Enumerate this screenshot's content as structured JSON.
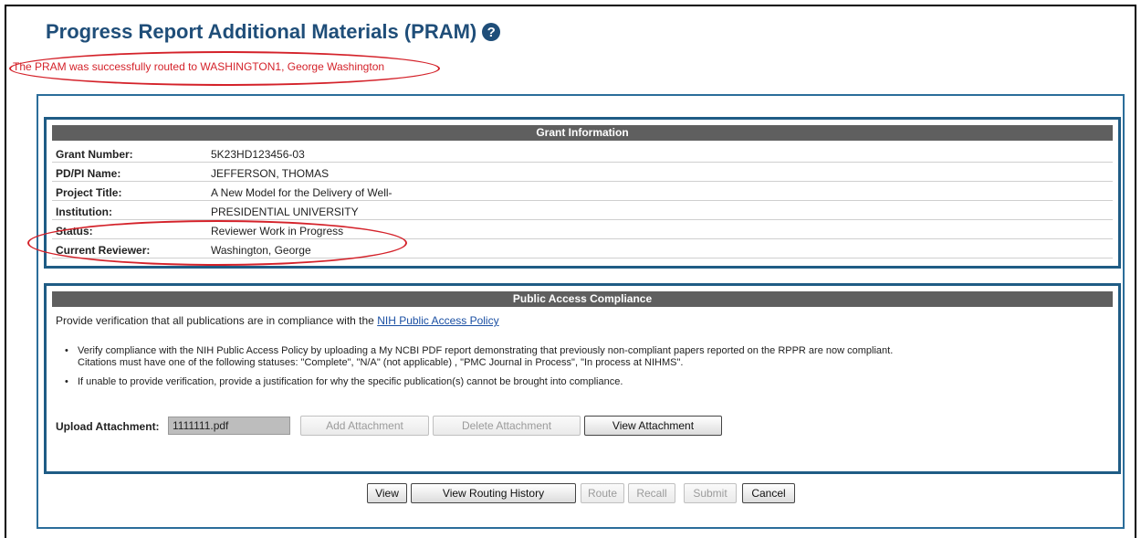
{
  "page": {
    "title": "Progress Report Additional Materials (PRAM)",
    "help_icon": "question-circle-icon",
    "success_message": "The PRAM was successfully routed to WASHINGTON1, George Washington"
  },
  "grant_info": {
    "header": "Grant Information",
    "rows": [
      {
        "label": "Grant Number:",
        "value": "5K23HD123456-03"
      },
      {
        "label": "PD/PI Name:",
        "value": "JEFFERSON, THOMAS"
      },
      {
        "label": "Project Title:",
        "value": "A New Model for the Delivery of Well-"
      },
      {
        "label": "Institution:",
        "value": "PRESIDENTIAL UNIVERSITY"
      },
      {
        "label": "Status:",
        "value": "Reviewer Work in Progress"
      },
      {
        "label": "Current Reviewer:",
        "value": "Washington, George"
      }
    ]
  },
  "public_access": {
    "header": "Public Access Compliance",
    "intro": "Provide verification that all publications are in compliance with the",
    "policy_link": "NIH Public Access Policy",
    "bullet1_line1": "Verify compliance with the NIH Public Access Policy by uploading a My NCBI PDF report demonstrating that previously non-compliant papers reported on the RPPR are now compliant.",
    "bullet1_line2": "Citations must have one of the following statuses: \"Complete\", \"N/A\" (not applicable) , \"PMC Journal in Process\", \"In process at NIHMS\".",
    "bullet2": "If unable to provide verification, provide a justification for why the specific publication(s) cannot be brought into compliance.",
    "upload_label": "Upload Attachment:",
    "upload_value": "1111111.pdf",
    "add_attachment": "Add Attachment",
    "delete_attachment": "Delete Attachment",
    "view_attachment": "View Attachment"
  },
  "actions": {
    "view": "View",
    "view_routing_history": "View Routing History",
    "route": "Route",
    "recall": "Recall",
    "submit": "Submit",
    "cancel": "Cancel"
  },
  "colors": {
    "title": "#1f4e79",
    "success": "#d4222a",
    "section_border": "#1f5c85",
    "header_bg": "#5f5f5f"
  }
}
